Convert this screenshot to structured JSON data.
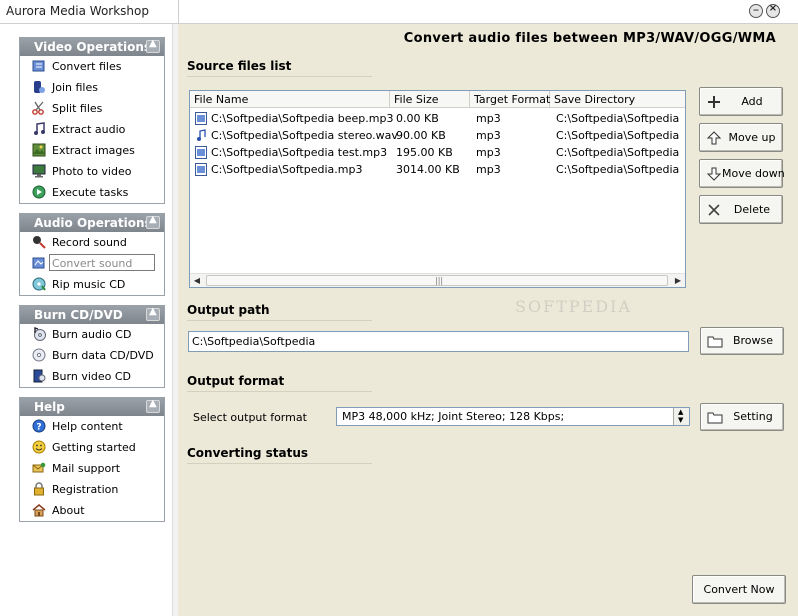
{
  "window": {
    "title": "Aurora Media Workshop"
  },
  "sidebar": {
    "groups": [
      {
        "title": "Video Operations",
        "items": [
          {
            "label": "Convert files",
            "icon": "convert-files-icon"
          },
          {
            "label": "Join files",
            "icon": "join-files-icon"
          },
          {
            "label": "Split files",
            "icon": "scissors-icon"
          },
          {
            "label": "Extract audio",
            "icon": "music-note-icon"
          },
          {
            "label": "Extract images",
            "icon": "image-icon"
          },
          {
            "label": "Photo to video",
            "icon": "monitor-icon"
          },
          {
            "label": "Execute tasks",
            "icon": "tasks-icon"
          }
        ]
      },
      {
        "title": "Audio Operations",
        "items": [
          {
            "label": "Record sound",
            "icon": "microphone-icon"
          },
          {
            "label": "Convert sound",
            "icon": "convert-sound-icon",
            "selected": true
          },
          {
            "label": "Rip music CD",
            "icon": "rip-cd-icon"
          }
        ]
      },
      {
        "title": "Burn CD/DVD",
        "items": [
          {
            "label": "Burn audio CD",
            "icon": "audio-cd-icon"
          },
          {
            "label": "Burn data CD/DVD",
            "icon": "data-cd-icon"
          },
          {
            "label": "Burn video CD",
            "icon": "video-cd-icon"
          }
        ]
      },
      {
        "title": "Help",
        "items": [
          {
            "label": "Help content",
            "icon": "help-icon"
          },
          {
            "label": "Getting started",
            "icon": "smiley-icon"
          },
          {
            "label": "Mail support",
            "icon": "mail-icon"
          },
          {
            "label": "Registration",
            "icon": "lock-icon"
          },
          {
            "label": "About",
            "icon": "home-icon"
          }
        ]
      }
    ]
  },
  "main": {
    "heading": "Convert audio files between  MP3/WAV/OGG/WMA",
    "source_section": "Source files list",
    "columns": [
      "File Name",
      "File Size",
      "Target Format",
      "Save Directory"
    ],
    "files": [
      {
        "name": "C:\\Softpedia\\Softpedia beep.mp3",
        "size": "0.00 KB",
        "format": "mp3",
        "dir": "C:\\Softpedia\\Softpedia",
        "icon": "mp3-file-icon"
      },
      {
        "name": "C:\\Softpedia\\Softpedia stereo.wav",
        "size": "90.00 KB",
        "format": "mp3",
        "dir": "C:\\Softpedia\\Softpedia",
        "icon": "wav-file-icon"
      },
      {
        "name": "C:\\Softpedia\\Softpedia test.mp3",
        "size": "195.00 KB",
        "format": "mp3",
        "dir": "C:\\Softpedia\\Softpedia",
        "icon": "mp3-file-icon"
      },
      {
        "name": "C:\\Softpedia\\Softpedia.mp3",
        "size": "3014.00 KB",
        "format": "mp3",
        "dir": "C:\\Softpedia\\Softpedia",
        "icon": "mp3-file-icon"
      }
    ],
    "buttons": {
      "add": "Add",
      "move_up": "Move up",
      "move_down": "Move down",
      "delete": "Delete"
    },
    "output_path_section": "Output path",
    "output_path_value": "C:\\Softpedia\\Softpedia",
    "browse": "Browse",
    "output_format_section": "Output format",
    "select_format_label": "Select output format",
    "format_value": "MP3 48,000 kHz; Joint Stereo;  128 Kbps;",
    "setting": "Setting",
    "status_section": "Converting status",
    "convert_now": "Convert Now",
    "watermark": "SOFTPEDIA"
  }
}
